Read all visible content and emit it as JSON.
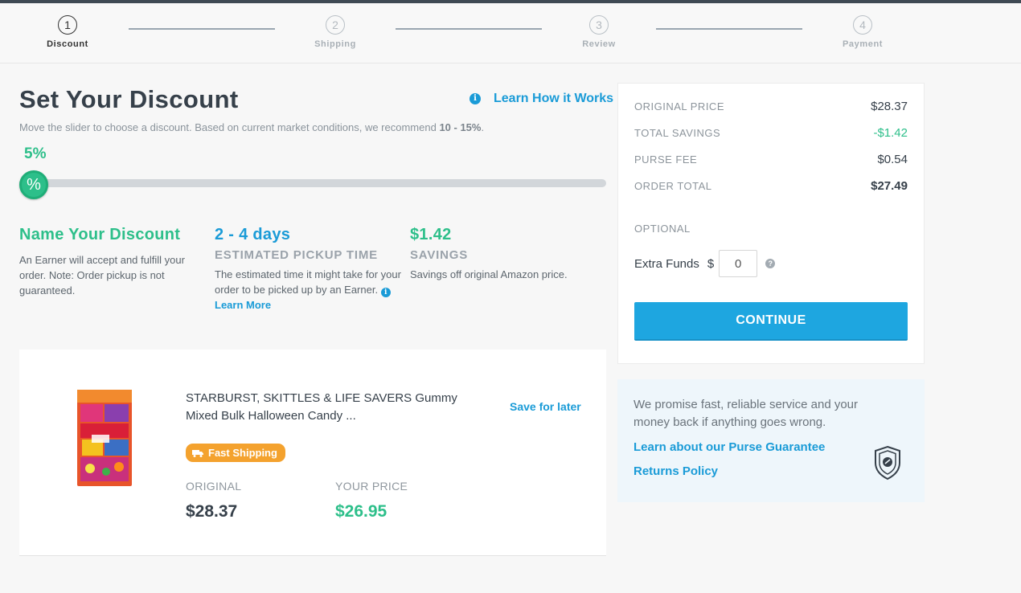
{
  "stepper": {
    "steps": [
      {
        "num": "1",
        "label": "Discount"
      },
      {
        "num": "2",
        "label": "Shipping"
      },
      {
        "num": "3",
        "label": "Review"
      },
      {
        "num": "4",
        "label": "Payment"
      }
    ]
  },
  "discount": {
    "title": "Set Your Discount",
    "learn_how": "Learn How it Works",
    "subtitle_prefix": "Move the slider to choose a discount. Based on current market conditions, we recommend ",
    "subtitle_range": "10 - 15%",
    "subtitle_suffix": ".",
    "slider_value_label": "5%",
    "slider_value": 5,
    "slider_handle_symbol": "%"
  },
  "info": {
    "name_title": "Name Your Discount",
    "name_text": "An Earner will accept and fulfill your order. Note: Order pickup is not guaranteed.",
    "days_title": "2 - 4 days",
    "days_caption": "ESTIMATED PICKUP TIME",
    "days_text": "The estimated time it might take for your order to be picked up by an Earner.",
    "days_link": "Learn More",
    "savings_title": "$1.42",
    "savings_caption": "SAVINGS",
    "savings_text": "Savings off original Amazon price."
  },
  "product": {
    "name": "STARBURST, SKITTLES & LIFE SAVERS Gummy Mixed Bulk Halloween Candy ...",
    "save_later": "Save for later",
    "badge": "Fast Shipping",
    "original_label": "ORIGINAL",
    "original_price": "$28.37",
    "your_price_label": "YOUR PRICE",
    "your_price": "$26.95"
  },
  "summary": {
    "original_price_label": "ORIGINAL PRICE",
    "original_price": "$28.37",
    "total_savings_label": "TOTAL SAVINGS",
    "total_savings": "-$1.42",
    "purse_fee_label": "PURSE FEE",
    "purse_fee": "$0.54",
    "order_total_label": "ORDER TOTAL",
    "order_total": "$27.49",
    "optional_label": "OPTIONAL",
    "extra_funds_label": "Extra Funds",
    "currency": "$",
    "extra_funds_value": "0",
    "continue": "CONTINUE"
  },
  "guarantee": {
    "text": "We promise fast, reliable service and your money back if anything goes wrong.",
    "link1": "Learn about our Purse Guarantee",
    "link2": "Returns Policy"
  },
  "colors": {
    "accent_blue": "#1a9bd7",
    "accent_green": "#2dbf8a",
    "badge_orange": "#f4a22e"
  }
}
